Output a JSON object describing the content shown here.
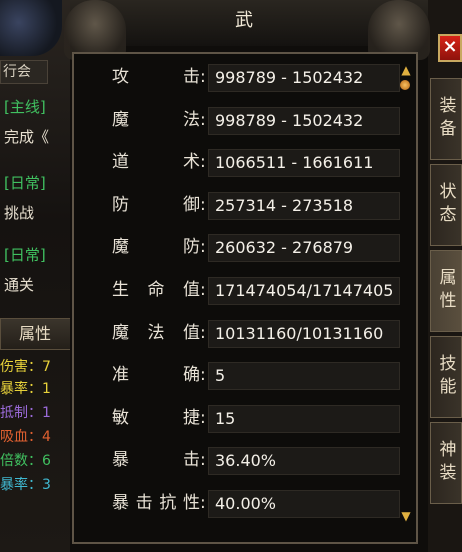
{
  "title": "武",
  "close_label": "×",
  "background": {
    "guild": "行会",
    "quest_main": "[主线]",
    "quest_main_text": "完成《",
    "quest_daily1": "[日常]",
    "quest_daily1_text": "挑战",
    "quest_daily2": "[日常]",
    "quest_daily2_text": "通关",
    "attr_tab": "属性",
    "stats": [
      {
        "label": "伤害：7",
        "color": "#e8d23a"
      },
      {
        "label": "暴率：1",
        "color": "#e8d23a"
      },
      {
        "label": "抵制：1",
        "color": "#9a6ad8"
      },
      {
        "label": "吸血：4",
        "color": "#e06030"
      },
      {
        "label": "倍数：6",
        "color": "#40c060"
      },
      {
        "label": "暴率：3",
        "color": "#40b8d0"
      }
    ]
  },
  "side_tabs": [
    {
      "label": "装备"
    },
    {
      "label": "状态"
    },
    {
      "label": "属性"
    },
    {
      "label": "技能"
    },
    {
      "label": "神装"
    }
  ],
  "stats": [
    {
      "label": [
        "攻",
        "击"
      ],
      "value": "998789 - 1502432"
    },
    {
      "label": [
        "魔",
        "法"
      ],
      "value": "998789 - 1502432"
    },
    {
      "label": [
        "道",
        "术"
      ],
      "value": "1066511 - 1661611"
    },
    {
      "label": [
        "防",
        "御"
      ],
      "value": "257314 - 273518"
    },
    {
      "label": [
        "魔",
        "防"
      ],
      "value": "260632 - 276879"
    },
    {
      "label": [
        "生",
        "命",
        "值"
      ],
      "value": "171474054/17147405"
    },
    {
      "label": [
        "魔",
        "法",
        "值"
      ],
      "value": "10131160/10131160"
    },
    {
      "label": [
        "准",
        "确"
      ],
      "value": "5"
    },
    {
      "label": [
        "敏",
        "捷"
      ],
      "value": "15"
    },
    {
      "label": [
        "暴",
        "击"
      ],
      "value": "36.40%"
    },
    {
      "label": [
        "暴",
        "击",
        "抗",
        "性"
      ],
      "value": "40.00%"
    }
  ],
  "scroll": {
    "up_icon": "▲",
    "down_icon": "▼"
  }
}
